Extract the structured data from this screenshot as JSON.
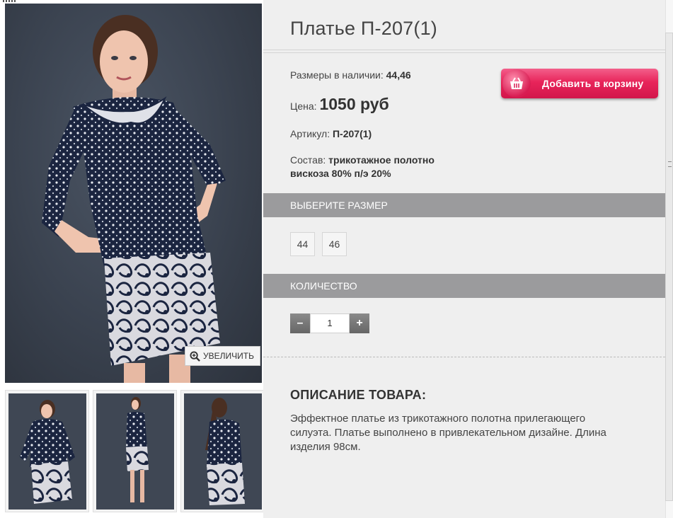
{
  "product": {
    "title": "Платье П-207(1)",
    "sizes_label": "Размеры в наличии:",
    "sizes_value": "44,46",
    "price_label": "Цена:",
    "price_value": "1050 руб",
    "sku_label": "Артикул:",
    "sku_value": "П-207(1)",
    "composition_label": "Состав:",
    "composition_line1": "трикотажное полотно",
    "composition_line2": "вискоза 80% п/э 20%"
  },
  "cart_button": {
    "label": "Добавить в корзину",
    "icon": "basket-icon",
    "color": "#e8245a"
  },
  "gallery": {
    "zoom_label": "увеличить",
    "zoom_icon": "magnifier-plus-icon",
    "thumbnails": [
      "thumb-front",
      "thumb-full-length",
      "thumb-back"
    ]
  },
  "size_section": {
    "title": "Выберите размер",
    "sizes": [
      "44",
      "46"
    ]
  },
  "quantity_section": {
    "title": "Количество",
    "minus": "–",
    "value": "1",
    "plus": "+"
  },
  "description": {
    "title": "Описание товара:",
    "text": "Эффектное платье из трикотажного полотна прилегающего силуэта. Платье выполнено в привлекательном дизайне. Длина изделия 98см."
  },
  "colors": {
    "section_bar": "#9b9b9d",
    "panel": "#efefef",
    "dress": "#1b2540"
  }
}
